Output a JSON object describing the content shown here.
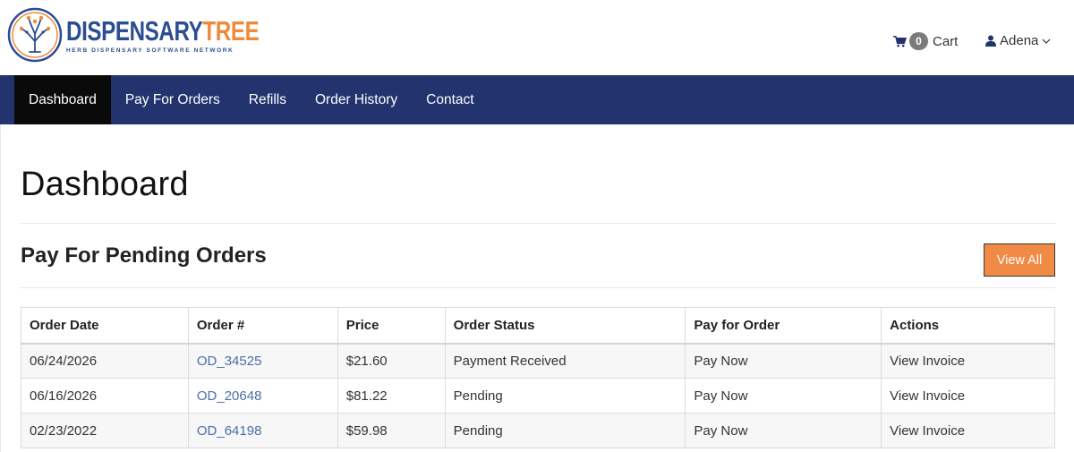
{
  "brand": {
    "name_part1": "DISPENSARY",
    "name_part2": "TREE",
    "tagline": "HERB DISPENSARY SOFTWARE NETWORK",
    "colors": {
      "blue": "#2b4d92",
      "orange": "#ef8a3c"
    }
  },
  "header": {
    "cart_count": "0",
    "cart_label": "Cart",
    "user_name": "Adena",
    "cart_icon": "shopping-cart-icon",
    "user_icon": "user-icon"
  },
  "nav": {
    "items": [
      {
        "label": "Dashboard",
        "active": true
      },
      {
        "label": "Pay For Orders",
        "active": false
      },
      {
        "label": "Refills",
        "active": false
      },
      {
        "label": "Order History",
        "active": false
      },
      {
        "label": "Contact",
        "active": false
      }
    ],
    "background": "#23336e",
    "active_background": "#0a0a0a"
  },
  "main": {
    "page_title": "Dashboard",
    "section_title": "Pay For Pending Orders",
    "view_all_label": "View All",
    "accent": "#f08a44"
  },
  "table": {
    "headers": [
      "Order Date",
      "Order #",
      "Price",
      "Order Status",
      "Pay for Order",
      "Actions"
    ],
    "rows": [
      {
        "date": "06/24/2026",
        "order": "OD_34525",
        "price": "$21.60",
        "status": "Payment Received",
        "pay": "Pay Now",
        "action": "View Invoice"
      },
      {
        "date": "06/16/2026",
        "order": "OD_20648",
        "price": "$81.22",
        "status": "Pending",
        "pay": "Pay Now",
        "action": "View Invoice"
      },
      {
        "date": "02/23/2022",
        "order": "OD_64198",
        "price": "$59.98",
        "status": "Pending",
        "pay": "Pay Now",
        "action": "View Invoice"
      }
    ]
  }
}
